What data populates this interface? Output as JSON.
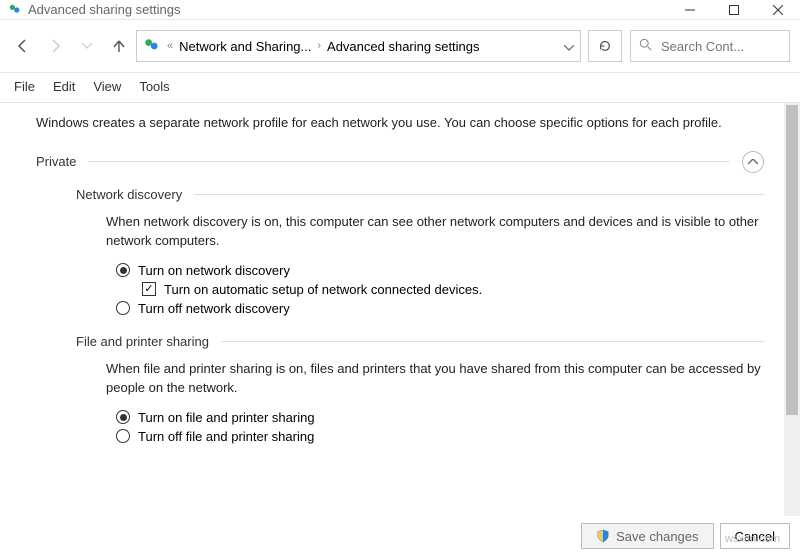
{
  "titlebar": {
    "title": "Advanced sharing settings"
  },
  "breadcrumb": {
    "parent": "Network and Sharing...",
    "current": "Advanced sharing settings"
  },
  "search": {
    "placeholder": "Search Cont..."
  },
  "menubar": {
    "file": "File",
    "edit": "Edit",
    "view": "View",
    "tools": "Tools"
  },
  "intro": "Windows creates a separate network profile for each network you use. You can choose specific options for each profile.",
  "sections": {
    "private": {
      "title": "Private",
      "network_discovery": {
        "title": "Network discovery",
        "desc": "When network discovery is on, this computer can see other network computers and devices and is visible to other network computers.",
        "opt_on": "Turn on network discovery",
        "opt_auto": "Turn on automatic setup of network connected devices.",
        "opt_off": "Turn off network discovery"
      },
      "file_printer": {
        "title": "File and printer sharing",
        "desc": "When file and printer sharing is on, files and printers that you have shared from this computer can be accessed by people on the network.",
        "opt_on": "Turn on file and printer sharing",
        "opt_off": "Turn off file and printer sharing"
      }
    }
  },
  "footer": {
    "save": "Save changes",
    "cancel": "Cancel"
  },
  "watermark": "wsxdn.com"
}
